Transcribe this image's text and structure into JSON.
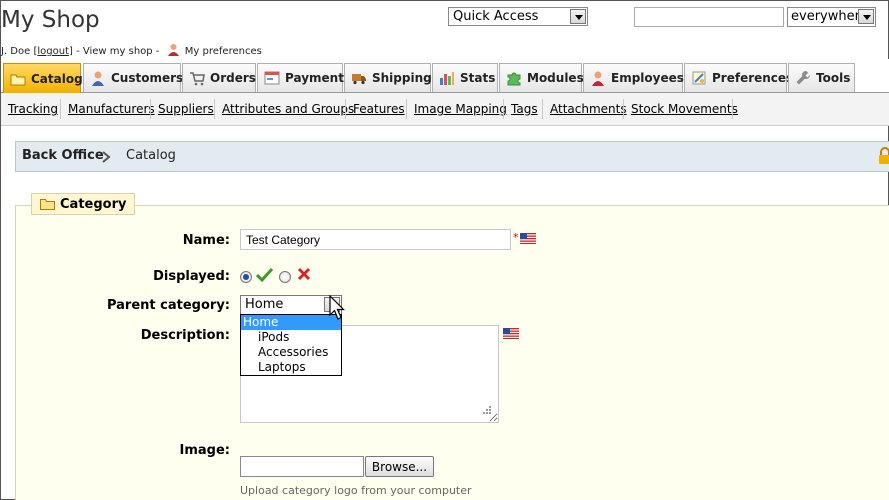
{
  "header": {
    "shop_title": "My Shop",
    "user_name": "J. Doe [",
    "logout_label": "logout",
    "user_sep": "] - ",
    "view_shop_label": "View my shop",
    "view_sep": " - ",
    "preferences_label": "My preferences",
    "quick_access": {
      "selected": "Quick Access"
    },
    "search": {
      "value": "",
      "scope_selected": "everywhere"
    }
  },
  "tabs": [
    {
      "label": "Catalog",
      "icon": "folder-icon",
      "active": true
    },
    {
      "label": "Customers",
      "icon": "user-icon"
    },
    {
      "label": "Orders",
      "icon": "cart-icon"
    },
    {
      "label": "Payment",
      "icon": "payment-icon"
    },
    {
      "label": "Shipping",
      "icon": "truck-icon"
    },
    {
      "label": "Stats",
      "icon": "chart-icon"
    },
    {
      "label": "Modules",
      "icon": "puzzle-icon"
    },
    {
      "label": "Employees",
      "icon": "employee-icon"
    },
    {
      "label": "Preferences",
      "icon": "preferences-icon"
    },
    {
      "label": "Tools",
      "icon": "wrench-icon"
    }
  ],
  "subtabs": [
    "Tracking",
    "Manufacturers",
    "Suppliers",
    "Attributes and Groups",
    "Features",
    "Image Mapping",
    "Tags",
    "Attachments",
    "Stock Movements"
  ],
  "breadcrumb": {
    "home": "Back Office",
    "current": "Catalog"
  },
  "form": {
    "legend": "Category",
    "name_label": "Name:",
    "name_value": "Test Category",
    "required_mark": "*",
    "displayed_label": "Displayed:",
    "displayed_value": "yes",
    "parent_label": "Parent category:",
    "parent_selected": "Home",
    "parent_options": [
      "Home",
      "iPods",
      "Accessories",
      "Laptops"
    ],
    "description_label": "Description:",
    "image_label": "Image:",
    "browse_label": "Browse...",
    "image_hint": "Upload category logo from your computer"
  },
  "colors": {
    "active_tab": "#f2b100",
    "breadcrumb_bg": "#e3ebf0",
    "fieldset_bg": "#fffff0",
    "dropdown_highlight": "#3399ff"
  }
}
